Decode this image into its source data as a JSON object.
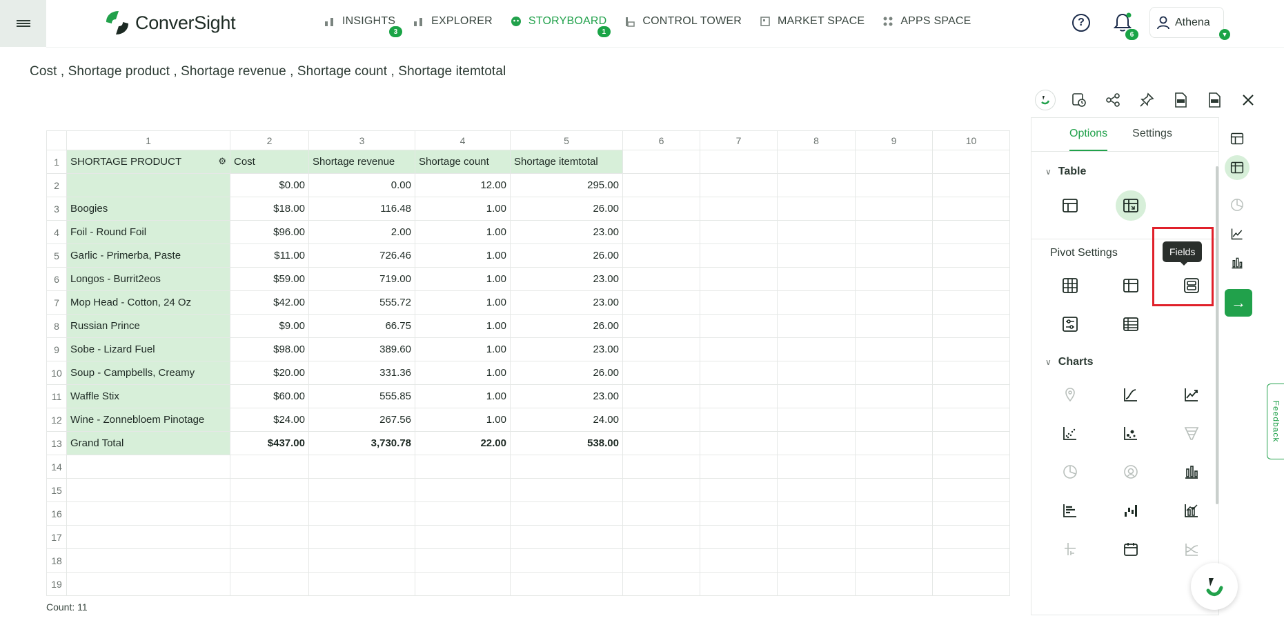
{
  "app": {
    "name": "ConverSight"
  },
  "nav": [
    {
      "label": "INSIGHTS",
      "icon": "bar-chart-icon",
      "badge": "3",
      "active": false
    },
    {
      "label": "EXPLORER",
      "icon": "bar-chart-icon",
      "badge": "",
      "active": false
    },
    {
      "label": "STORYBOARD",
      "icon": "storyboard-icon",
      "badge": "1",
      "active": true
    },
    {
      "label": "CONTROL TOWER",
      "icon": "tower-icon",
      "badge": "",
      "active": false
    },
    {
      "label": "MARKET SPACE",
      "icon": "store-icon",
      "badge": "",
      "active": false
    },
    {
      "label": "APPS SPACE",
      "icon": "apps-icon",
      "badge": "",
      "active": false
    }
  ],
  "header": {
    "notifications_count": "6",
    "user_name": "Athena"
  },
  "page": {
    "title": "Cost , Shortage product , Shortage revenue , Shortage count , Shortage itemtotal"
  },
  "sheet": {
    "column_headers": [
      "1",
      "2",
      "3",
      "4",
      "5",
      "6",
      "7",
      "8",
      "9",
      "10"
    ],
    "header_row": [
      "SHORTAGE PRODUCT",
      "Cost",
      "Shortage revenue",
      "Shortage count",
      "Shortage itemtotal"
    ],
    "rows": [
      {
        "n": "2",
        "product": "",
        "cost": "$0.00",
        "revenue": "0.00",
        "count": "12.00",
        "itemtotal": "295.00"
      },
      {
        "n": "3",
        "product": "Boogies",
        "cost": "$18.00",
        "revenue": "116.48",
        "count": "1.00",
        "itemtotal": "26.00"
      },
      {
        "n": "4",
        "product": "Foil - Round Foil",
        "cost": "$96.00",
        "revenue": "2.00",
        "count": "1.00",
        "itemtotal": "23.00"
      },
      {
        "n": "5",
        "product": "Garlic - Primerba, Paste",
        "cost": "$11.00",
        "revenue": "726.46",
        "count": "1.00",
        "itemtotal": "26.00"
      },
      {
        "n": "6",
        "product": "Longos - Burrit2eos",
        "cost": "$59.00",
        "revenue": "719.00",
        "count": "1.00",
        "itemtotal": "23.00"
      },
      {
        "n": "7",
        "product": "Mop Head - Cotton, 24 Oz",
        "cost": "$42.00",
        "revenue": "555.72",
        "count": "1.00",
        "itemtotal": "23.00"
      },
      {
        "n": "8",
        "product": "Russian Prince",
        "cost": "$9.00",
        "revenue": "66.75",
        "count": "1.00",
        "itemtotal": "26.00"
      },
      {
        "n": "9",
        "product": "Sobe - Lizard Fuel",
        "cost": "$98.00",
        "revenue": "389.60",
        "count": "1.00",
        "itemtotal": "23.00"
      },
      {
        "n": "10",
        "product": "Soup - Campbells, Creamy",
        "cost": "$20.00",
        "revenue": "331.36",
        "count": "1.00",
        "itemtotal": "26.00"
      },
      {
        "n": "11",
        "product": "Waffle Stix",
        "cost": "$60.00",
        "revenue": "555.85",
        "count": "1.00",
        "itemtotal": "23.00"
      },
      {
        "n": "12",
        "product": "Wine - Zonnebloem Pinotage",
        "cost": "$24.00",
        "revenue": "267.56",
        "count": "1.00",
        "itemtotal": "24.00"
      }
    ],
    "total_row": {
      "n": "13",
      "product": "Grand Total",
      "cost": "$437.00",
      "revenue": "3,730.78",
      "count": "22.00",
      "itemtotal": "538.00"
    },
    "empty_rows": [
      "14",
      "15",
      "16",
      "17",
      "18",
      "19"
    ],
    "first_row_number": "1",
    "count_label": "Count: 11"
  },
  "panel": {
    "tabs": [
      "Options",
      "Settings"
    ],
    "table_section": "Table",
    "pivot_section": "Pivot Settings",
    "charts_section": "Charts",
    "tooltip": "Fields"
  },
  "feedback_label": "Feedback",
  "colors": {
    "accent": "#21a14b",
    "header_fill": "#d7efd9",
    "highlight": "#e0202a"
  }
}
